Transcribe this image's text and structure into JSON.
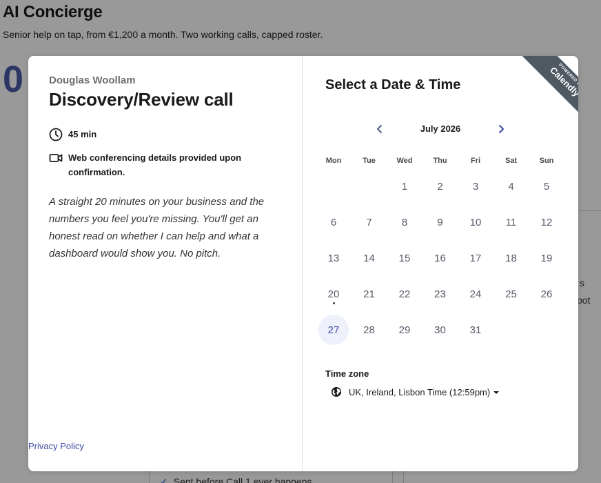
{
  "background": {
    "title": "AI Concierge",
    "subtitle": "Senior help on tap, from €1,200 a month. Two working calls, capped roster.",
    "big_number": "0",
    "fragment_1": "s",
    "fragment_2": "pot",
    "checklist_item": "Sent before Call 1 ever happens"
  },
  "event": {
    "organizer": "Douglas Woollam",
    "name": "Discovery/Review call",
    "duration": "45 min",
    "conferencing": "Web conferencing details provided upon confirmation.",
    "description": "A straight 20 minutes on your business and the numbers you feel you're missing. You'll get an honest read on whether I can help and what a dashboard would show you. No pitch.",
    "privacy_link": "Privacy Policy"
  },
  "scheduler": {
    "title": "Select a Date & Time",
    "badge_small": "POWERED BY",
    "badge_brand": "Calendly",
    "month_label": "July 2026",
    "weekdays": [
      "Mon",
      "Tue",
      "Wed",
      "Thu",
      "Fri",
      "Sat",
      "Sun"
    ],
    "days": [
      "1",
      "2",
      "3",
      "4",
      "5",
      "6",
      "7",
      "8",
      "9",
      "10",
      "11",
      "12",
      "13",
      "14",
      "15",
      "16",
      "17",
      "18",
      "19",
      "20",
      "21",
      "22",
      "23",
      "24",
      "25",
      "26",
      "27",
      "28",
      "29",
      "30",
      "31"
    ],
    "first_weekday_index": 2,
    "today": 20,
    "selected": 27,
    "timezone_label": "Time zone",
    "timezone_value": "UK, Ireland, Lisbon Time (12:59pm)"
  },
  "colors": {
    "accent": "#3b4aa0",
    "selected_bg": "#eef0fb",
    "badge_bg": "#505862"
  },
  "icons": {
    "duration": "clock-icon",
    "conferencing": "video-camera-icon",
    "timezone": "globe-icon",
    "prev": "chevron-left-icon",
    "next": "chevron-right-icon"
  }
}
